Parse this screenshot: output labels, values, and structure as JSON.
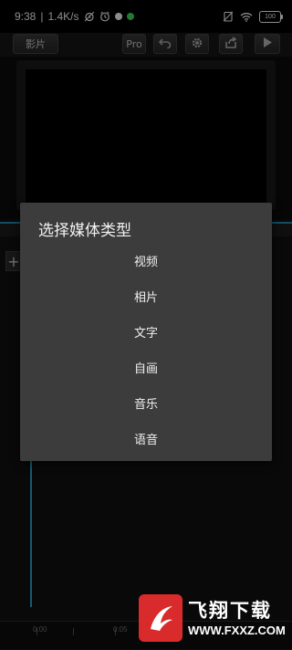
{
  "status_bar": {
    "time": "9:38",
    "separator": "|",
    "speed": "1.4K/s",
    "battery": "100"
  },
  "toolbar": {
    "movie_label": "影片",
    "pro_label": "Pro"
  },
  "dialog": {
    "title": "选择媒体类型",
    "options": [
      "视频",
      "相片",
      "文字",
      "自画",
      "音乐",
      "语音"
    ]
  },
  "timeline": {
    "add_label": "+",
    "ruler_labels": [
      "0:00",
      "0:05"
    ]
  },
  "watermark": {
    "brand_text": "飞翔下载",
    "url": "WWW.FXXZ.COM"
  },
  "colors": {
    "accent": "#2aa3cf",
    "dialog_bg": "#3c3c3c",
    "status_green": "#3ddc5c",
    "watermark_red": "#d92b2b"
  }
}
